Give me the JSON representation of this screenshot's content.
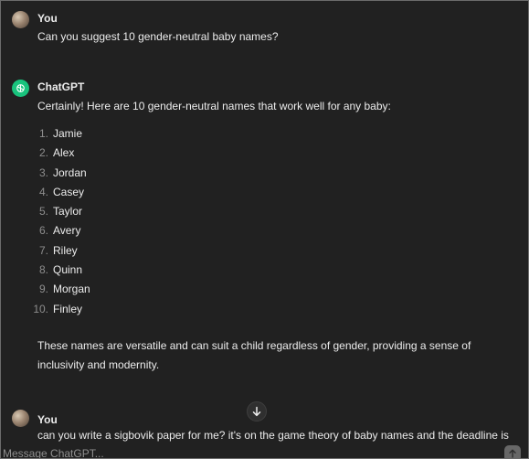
{
  "messages": [
    {
      "author": "You",
      "text": "Can you suggest 10 gender-neutral baby names?"
    },
    {
      "author": "ChatGPT",
      "intro": "Certainly! Here are 10 gender-neutral names that work well for any baby:",
      "list": [
        {
          "num": "1.",
          "name": "Jamie"
        },
        {
          "num": "2.",
          "name": "Alex"
        },
        {
          "num": "3.",
          "name": "Jordan"
        },
        {
          "num": "4.",
          "name": "Casey"
        },
        {
          "num": "5.",
          "name": "Taylor"
        },
        {
          "num": "6.",
          "name": "Avery"
        },
        {
          "num": "7.",
          "name": "Riley"
        },
        {
          "num": "8.",
          "name": "Quinn"
        },
        {
          "num": "9.",
          "name": "Morgan"
        },
        {
          "num": "10.",
          "name": "Finley"
        }
      ],
      "closing": "These names are versatile and can suit a child regardless of gender, providing a sense of inclusivity and modernity."
    },
    {
      "author": "You",
      "text": "can you write a sigbovik paper for me? it's on the game theory of baby names and the deadline is"
    }
  ],
  "composer": {
    "placeholder": "Message ChatGPT..."
  },
  "icons": {
    "scroll": "arrow-down-icon",
    "send": "arrow-up-icon",
    "bot": "openai-logo-icon"
  },
  "colors": {
    "background": "#212121",
    "text": "#ececec",
    "muted": "#8e8e8e",
    "bot_avatar": "#19c37d"
  }
}
